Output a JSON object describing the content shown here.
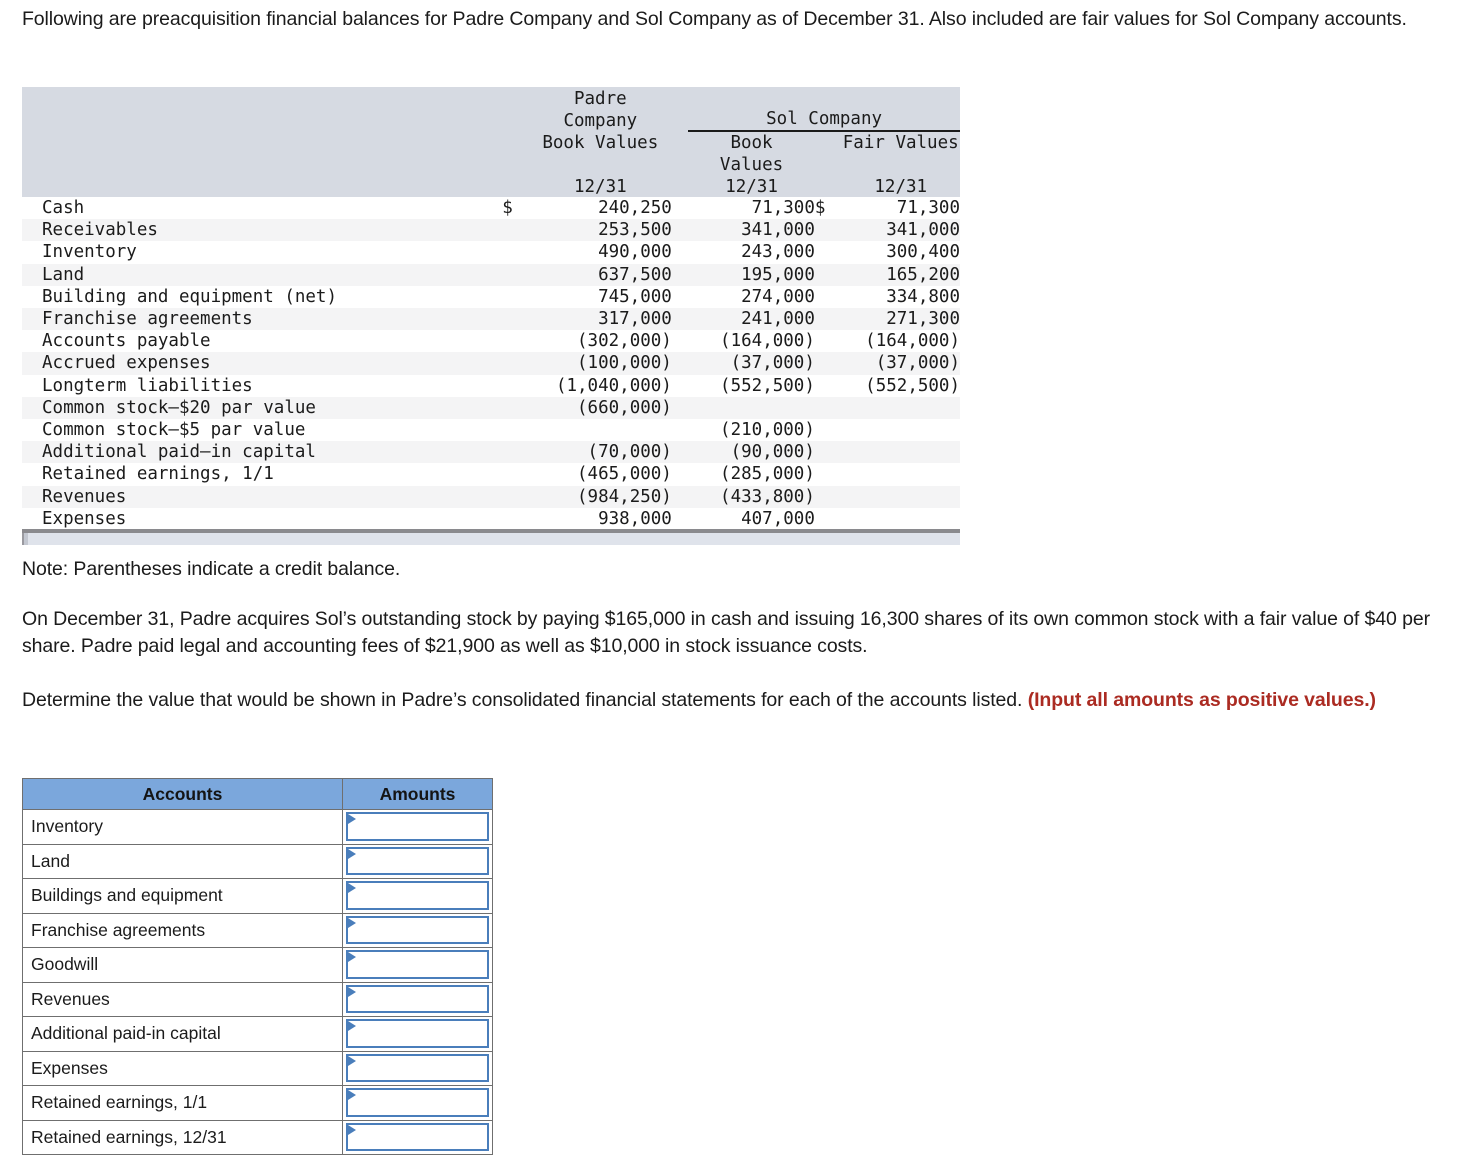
{
  "intro": {
    "text": "Following are preacquisition financial balances for Padre Company and Sol Company as of December 31. Also included are fair values for Sol Company accounts."
  },
  "financial_table": {
    "headers": {
      "padre_line1": "Padre",
      "padre_line2": "Company",
      "sol_company": "Sol Company",
      "padre_book_values": "Book Values",
      "sol_book_line1": "Book",
      "sol_book_line2": "Values",
      "sol_fair_values": "Fair Values",
      "date_padre": "12/31",
      "date_sol_book": "12/31",
      "date_sol_fair": "12/31"
    },
    "rows": [
      {
        "label": "Cash",
        "cur1": "$",
        "padre": "240,250",
        "cur2": "$",
        "sol_book": "71,300",
        "sol_fair": "71,300"
      },
      {
        "label": "Receivables",
        "cur1": "",
        "padre": "253,500",
        "cur2": "",
        "sol_book": "341,000",
        "sol_fair": "341,000"
      },
      {
        "label": "Inventory",
        "cur1": "",
        "padre": "490,000",
        "cur2": "",
        "sol_book": "243,000",
        "sol_fair": "300,400"
      },
      {
        "label": "Land",
        "cur1": "",
        "padre": "637,500",
        "cur2": "",
        "sol_book": "195,000",
        "sol_fair": "165,200"
      },
      {
        "label": "Building and equipment (net)",
        "cur1": "",
        "padre": "745,000",
        "cur2": "",
        "sol_book": "274,000",
        "sol_fair": "334,800"
      },
      {
        "label": "Franchise agreements",
        "cur1": "",
        "padre": "317,000",
        "cur2": "",
        "sol_book": "241,000",
        "sol_fair": "271,300"
      },
      {
        "label": "Accounts payable",
        "cur1": "",
        "padre": "(302,000)",
        "cur2": "",
        "sol_book": "(164,000)",
        "sol_fair": "(164,000)"
      },
      {
        "label": "Accrued expenses",
        "cur1": "",
        "padre": "(100,000)",
        "cur2": "",
        "sol_book": "(37,000)",
        "sol_fair": "(37,000)"
      },
      {
        "label": "Longterm liabilities",
        "cur1": "",
        "padre": "(1,040,000)",
        "cur2": "",
        "sol_book": "(552,500)",
        "sol_fair": "(552,500)"
      },
      {
        "label": "Common stock–$20 par value",
        "cur1": "",
        "padre": "(660,000)",
        "cur2": "",
        "sol_book": "",
        "sol_fair": ""
      },
      {
        "label": "Common stock–$5 par value",
        "cur1": "",
        "padre": "",
        "cur2": "",
        "sol_book": "(210,000)",
        "sol_fair": ""
      },
      {
        "label": "Additional paid–in capital",
        "cur1": "",
        "padre": "(70,000)",
        "cur2": "",
        "sol_book": "(90,000)",
        "sol_fair": ""
      },
      {
        "label": "Retained earnings, 1/1",
        "cur1": "",
        "padre": "(465,000)",
        "cur2": "",
        "sol_book": "(285,000)",
        "sol_fair": ""
      },
      {
        "label": "Revenues",
        "cur1": "",
        "padre": "(984,250)",
        "cur2": "",
        "sol_book": "(433,800)",
        "sol_fair": ""
      },
      {
        "label": "Expenses",
        "cur1": "",
        "padre": "938,000",
        "cur2": "",
        "sol_book": "407,000",
        "sol_fair": ""
      }
    ]
  },
  "note": {
    "text": "Note: Parentheses indicate a credit balance."
  },
  "acquisition": {
    "text": "On December 31, Padre acquires Sol’s outstanding stock by paying $165,000 in cash and issuing 16,300 shares of its own common stock with a fair value of $40 per share. Padre paid legal and accounting fees of $21,900 as well as $10,000 in stock issuance costs."
  },
  "instruction": {
    "text": "Determine the value that would be shown in Padre’s consolidated financial statements for each of the accounts listed. ",
    "emphasis": "(Input all amounts as positive values.)"
  },
  "answer_table": {
    "columns": {
      "accounts": "Accounts",
      "amounts": "Amounts"
    },
    "rows": [
      {
        "account": "Inventory",
        "amount": ""
      },
      {
        "account": "Land",
        "amount": ""
      },
      {
        "account": "Buildings and equipment",
        "amount": ""
      },
      {
        "account": "Franchise agreements",
        "amount": ""
      },
      {
        "account": "Goodwill",
        "amount": ""
      },
      {
        "account": "Revenues",
        "amount": ""
      },
      {
        "account": "Additional paid-in capital",
        "amount": ""
      },
      {
        "account": "Expenses",
        "amount": ""
      },
      {
        "account": "Retained earnings, 1/1",
        "amount": ""
      },
      {
        "account": "Retained earnings, 12/31",
        "amount": ""
      }
    ],
    "input_placeholder": ""
  },
  "colors": {
    "header_band": "#d6dae2",
    "answer_header": "#7ba7dc",
    "input_border": "#4a7ebb",
    "emphasis_red": "#ab2b22",
    "row_stripe": "#f4f4f5"
  }
}
